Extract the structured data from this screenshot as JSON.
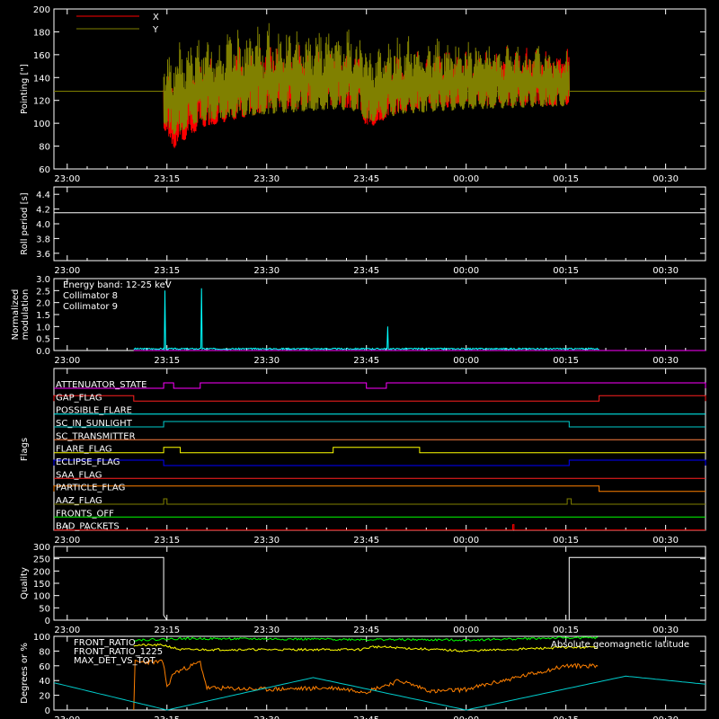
{
  "time_axis": {
    "tick_labels": [
      "23:00",
      "23:15",
      "23:30",
      "23:45",
      "00:00",
      "00:15",
      "00:30"
    ],
    "tick_minutes": [
      0,
      15,
      30,
      45,
      60,
      75,
      90
    ],
    "range_minutes": [
      -2,
      96
    ]
  },
  "colors": {
    "background": "#000000",
    "axes": "#ffffff",
    "x_pointing": "#ff0000",
    "y_pointing": "#808000",
    "collimator_8": "#00ffff",
    "collimator_9": "#ff00ff",
    "front_ratio": "#ffff00",
    "front_ratio_alt": "#00ff00",
    "max_det_vs_tot": "#ff8000",
    "geomagnetic_latitude": "#00cccc"
  },
  "chart_data": [
    {
      "id": "pointing",
      "type": "line",
      "ylabel": "Pointing [\"]",
      "ylim": [
        60,
        200
      ],
      "yticks": [
        60,
        80,
        100,
        120,
        140,
        160,
        180,
        200
      ],
      "legend": [
        "X",
        "Y"
      ],
      "legend_position": "top-left",
      "constant_level": 128,
      "data_window_minutes": [
        14.5,
        75.5
      ],
      "series": [
        {
          "name": "X",
          "envelope_x_minutes": [
            14.5,
            16,
            20,
            30,
            40,
            44,
            45,
            50,
            60,
            75.5
          ],
          "upper": [
            158,
            145,
            165,
            175,
            172,
            168,
            150,
            162,
            168,
            168
          ],
          "lower": [
            95,
            78,
            96,
            110,
            115,
            112,
            95,
            110,
            115,
            115
          ]
        },
        {
          "name": "Y",
          "envelope_x_minutes": [
            14.5,
            16,
            20,
            30,
            40,
            44,
            45,
            50,
            60,
            75.5
          ],
          "upper": [
            165,
            170,
            180,
            188,
            186,
            182,
            172,
            180,
            176,
            170
          ],
          "lower": [
            100,
            90,
            102,
            108,
            112,
            110,
            100,
            108,
            112,
            115
          ]
        }
      ]
    },
    {
      "id": "roll_period",
      "type": "line",
      "ylabel": "Roll period [s]",
      "ylim": [
        3.5,
        4.5
      ],
      "yticks": [
        3.6,
        3.8,
        4.0,
        4.2,
        4.4
      ],
      "series": [
        {
          "values_constant": 4.15
        }
      ]
    },
    {
      "id": "modulation",
      "type": "line",
      "ylabel": "Normalized modulation",
      "ylabel_lines": [
        "Normalized",
        "modulation"
      ],
      "ylim": [
        0,
        3
      ],
      "yticks": [
        0.0,
        0.5,
        1.0,
        1.5,
        2.0,
        2.5,
        3.0
      ],
      "annotation": "Energy band: 12-25 keV",
      "legend": [
        "Collimator 8",
        "Collimator 9"
      ],
      "legend_position": "top-left",
      "series": [
        {
          "name": "Collimator 8",
          "x": [
            10,
            14.5,
            14.7,
            14.9,
            20,
            20.2,
            20.4,
            45,
            48,
            48.2,
            48.4,
            80
          ],
          "y": [
            0.05,
            0.05,
            2.5,
            0.08,
            0.05,
            2.6,
            0.08,
            0.2,
            0.05,
            1.0,
            0.05,
            0.05
          ]
        },
        {
          "name": "Collimator 9",
          "x": [
            10,
            96
          ],
          "y": [
            0.0,
            0.0
          ]
        }
      ]
    },
    {
      "id": "flags",
      "type": "step",
      "ylabel": "Flags",
      "flags": [
        {
          "name": "ATTENUATOR_STATE",
          "color": "#ff00ff",
          "high": [
            [
              14.5,
              16
            ],
            [
              20,
              45
            ],
            [
              48,
              96
            ]
          ]
        },
        {
          "name": "GAP_FLAG",
          "color": "#ff2020",
          "high": [
            [
              -2,
              10
            ],
            [
              80,
              96
            ]
          ]
        },
        {
          "name": "POSSIBLE_FLARE",
          "color": "#00ffff",
          "high": []
        },
        {
          "name": "SC_IN_SUNLIGHT",
          "color": "#00cccc",
          "high": [
            [
              14.5,
              75.5
            ]
          ]
        },
        {
          "name": "SC_TRANSMITTER",
          "color": "#ff8040",
          "high": []
        },
        {
          "name": "FLARE_FLAG",
          "color": "#ffff00",
          "high": [
            [
              14.5,
              17
            ],
            [
              40,
              53
            ]
          ]
        },
        {
          "name": "ECLIPSE_FLAG",
          "color": "#0000ff",
          "high": [
            [
              -2,
              14.5
            ],
            [
              75.5,
              96
            ]
          ]
        },
        {
          "name": "SAA_FLAG",
          "color": "#ff2020",
          "high": []
        },
        {
          "name": "PARTICLE_FLAG",
          "color": "#ff8000",
          "high": [
            [
              -2,
              80
            ]
          ]
        },
        {
          "name": "AAZ_FLAG",
          "color": "#808000",
          "high": [
            [
              14.5,
              15
            ],
            [
              75.2,
              75.8
            ]
          ]
        },
        {
          "name": "FRONTS_OFF",
          "color": "#00ff00",
          "high": []
        },
        {
          "name": "BAD_PACKETS",
          "color": "#ff0000",
          "high": [
            [
              67,
              67.2
            ]
          ]
        }
      ]
    },
    {
      "id": "quality",
      "type": "step",
      "ylabel": "Quality",
      "ylim": [
        0,
        300
      ],
      "yticks": [
        0,
        50,
        100,
        150,
        200,
        250,
        300
      ],
      "series": [
        {
          "x": [
            -2,
            14.5,
            14.5,
            15,
            75.5,
            75.5,
            96
          ],
          "y": [
            255,
            255,
            20,
            0,
            0,
            255,
            255
          ]
        }
      ]
    },
    {
      "id": "ratios",
      "type": "line",
      "ylabel": "Degrees or %",
      "ylim": [
        0,
        100
      ],
      "yticks": [
        0,
        20,
        40,
        60,
        80,
        100
      ],
      "legend": [
        "FRONT_RATIO",
        "FRONT_RATIO_1225",
        "MAX_DET_VS_TOT"
      ],
      "annotation": "Absolute geomagnetic latitude",
      "series": [
        {
          "name": "FRONT_RATIO",
          "x": [
            10,
            14.5,
            17,
            20,
            44,
            46,
            60,
            75,
            80
          ],
          "y": [
            88,
            88,
            82,
            82,
            82,
            86,
            80,
            85,
            85
          ]
        },
        {
          "name": "FRONT_RATIO_1225",
          "x": [
            10,
            14.5,
            17,
            60,
            75,
            80
          ],
          "y": [
            95,
            96,
            97,
            95,
            98,
            98
          ]
        },
        {
          "name": "MAX_DET_VS_TOT",
          "x": [
            10,
            10,
            14.5,
            15,
            16,
            20,
            21,
            30,
            40,
            45,
            50,
            55,
            60,
            75,
            80,
            80
          ],
          "y": [
            0,
            65,
            65,
            30,
            50,
            65,
            30,
            28,
            30,
            25,
            40,
            25,
            28,
            60,
            60,
            0
          ]
        },
        {
          "name": "Absolute geomagnetic latitude",
          "x": [
            -2,
            15,
            37,
            60,
            84,
            96
          ],
          "y": [
            37,
            0,
            44,
            0,
            46,
            35
          ]
        }
      ]
    }
  ]
}
